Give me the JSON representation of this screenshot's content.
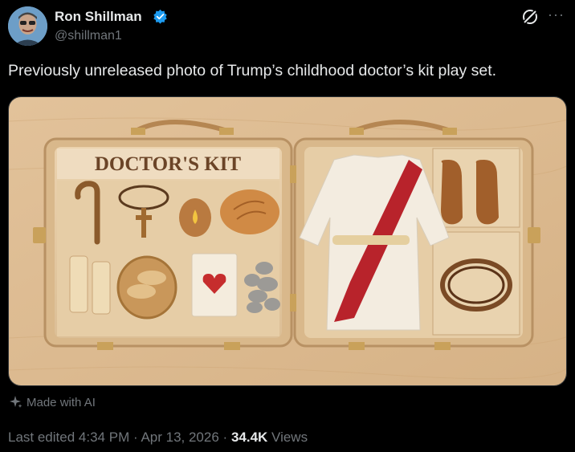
{
  "author": {
    "name": "Ron Shillman",
    "handle": "@shillman1",
    "verified_color": "#1d9bf0",
    "avatar_icon": "avatar"
  },
  "post": {
    "text": "Previously unreleased photo of Trump’s childhood doctor’s kit play set.",
    "image": {
      "case_label": "DOCTOR'S KIT"
    },
    "made_with_ai_label": "Made with AI",
    "meta": {
      "edited_prefix": "Last edited",
      "time": "4:34 PM",
      "separator": "·",
      "date": "Apr 13, 2026",
      "views_count": "34.4K",
      "views_label": "Views"
    }
  },
  "icons": {
    "grok": "grok-icon",
    "more": "more-icon",
    "sparkle": "sparkle-icon"
  }
}
